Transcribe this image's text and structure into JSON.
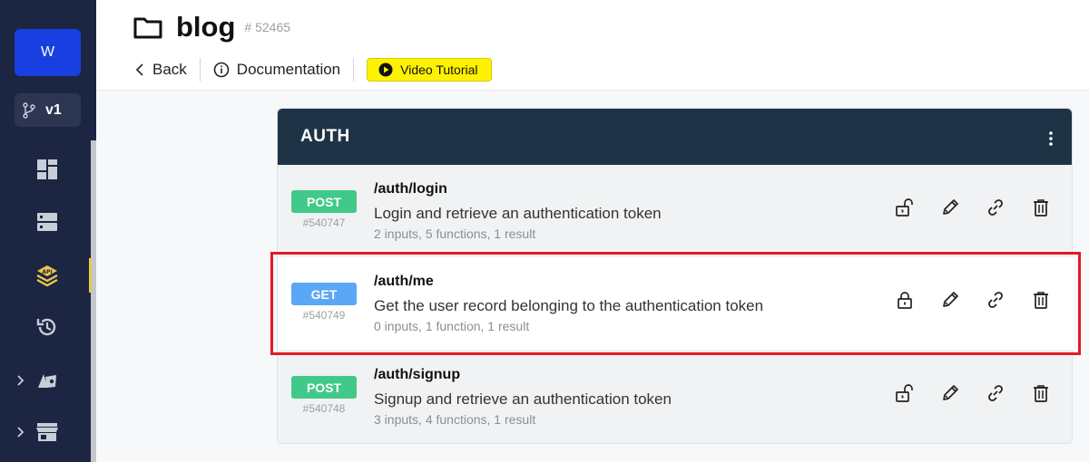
{
  "workspace": {
    "initial": "W"
  },
  "branch": {
    "label": "v1"
  },
  "sidebar": {
    "items": [
      {
        "icon": "dashboard-icon"
      },
      {
        "icon": "database-icon"
      },
      {
        "icon": "api-icon",
        "active": true
      },
      {
        "icon": "history-icon"
      },
      {
        "icon": "addons-icon",
        "expandable": true
      },
      {
        "icon": "marketplace-icon",
        "expandable": true
      }
    ],
    "active_color": "#e9c84a"
  },
  "header": {
    "title": "blog",
    "id": "# 52465",
    "back_label": "Back",
    "docs_label": "Documentation",
    "video_label": "Video Tutorial"
  },
  "group": {
    "title": "AUTH",
    "endpoints": [
      {
        "method": "POST",
        "id": "#540747",
        "path": "/auth/login",
        "description": "Login and retrieve an authentication token",
        "meta": "2 inputs, 5 functions, 1 result",
        "lock": "unlocked"
      },
      {
        "method": "GET",
        "id": "#540749",
        "path": "/auth/me",
        "description": "Get the user record belonging to the authentication token",
        "meta": "0 inputs, 1 function, 1 result",
        "lock": "locked",
        "selected": true
      },
      {
        "method": "POST",
        "id": "#540748",
        "path": "/auth/signup",
        "description": "Signup and retrieve an authentication token",
        "meta": "3 inputs, 4 functions, 1 result",
        "lock": "unlocked"
      }
    ]
  },
  "colors": {
    "post": "#41c98a",
    "get": "#5aa8f5",
    "header_bg": "#1e3446",
    "highlight": "#e01b24"
  }
}
